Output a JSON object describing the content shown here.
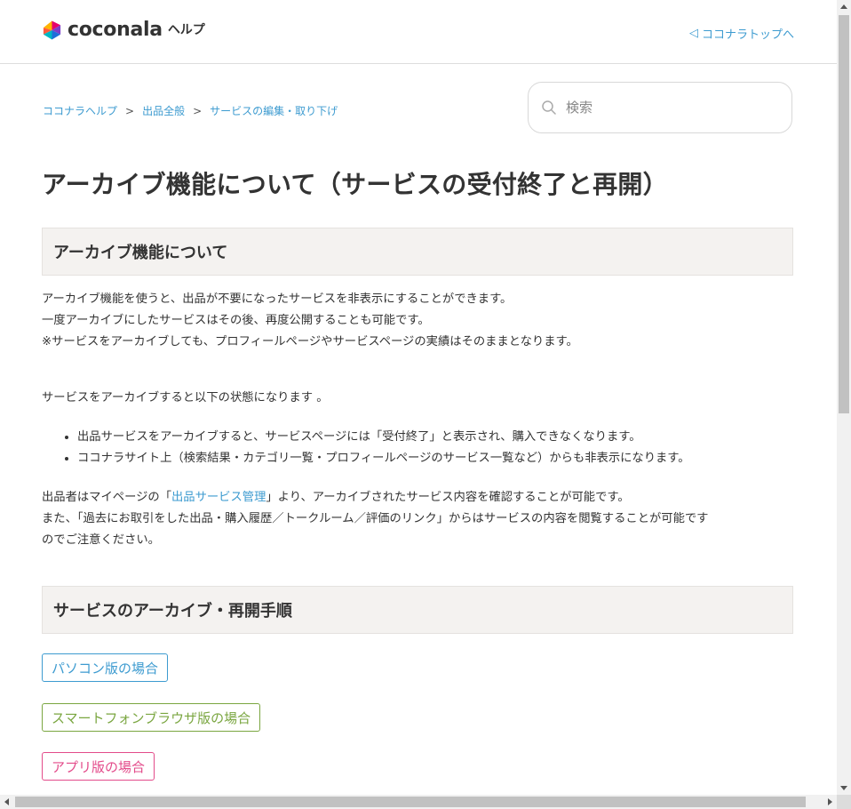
{
  "header": {
    "logo_text": "coconala",
    "logo_suffix": "ヘルプ",
    "top_link_label": "ココナラトップへ"
  },
  "breadcrumb": {
    "items": [
      {
        "label": "ココナラヘルプ"
      },
      {
        "label": "出品全般"
      },
      {
        "label": "サービスの編集・取り下げ"
      }
    ],
    "separator": ">"
  },
  "search": {
    "placeholder": "検索"
  },
  "article": {
    "title": "アーカイブ機能について（サービスの受付終了と再開）",
    "section1_heading": "アーカイブ機能について",
    "intro_lines": [
      "アーカイブ機能を使うと、出品が不要になったサービスを非表示にすることができます。",
      "一度アーカイブにしたサービスはその後、再度公開することも可能です。",
      "※サービスをアーカイブしても、プロフィールページやサービスページの実績はそのままとなります。"
    ],
    "state_intro": "サービスをアーカイブすると以下の状態になります 。",
    "bullets": [
      "出品サービスをアーカイブすると、サービスページには「受付終了」と表示され、購入できなくなります。",
      "ココナラサイト上（検索結果・カテゴリ一覧・プロフィールページのサービス一覧など）からも非表示になります。"
    ],
    "confirm_prefix": "出品者はマイページの「",
    "confirm_link": "出品サービス管理",
    "confirm_suffix": "」より、アーカイブされたサービス内容を確認することが可能です。",
    "notice_line1": "また、「過去にお取引をした出品・購入履歴／トークルーム／評価のリンク」からはサービスの内容を閲覧することが可能です",
    "notice_line2": "のでご注意ください。",
    "section2_heading": "サービスのアーカイブ・再開手順",
    "tags": {
      "pc": "パソコン版の場合",
      "smartphone": "スマートフォンブラウザ版の場合",
      "app": "アプリ版の場合"
    }
  },
  "colors": {
    "link": "#3d9bd0",
    "tag_pc": "#3d9bd0",
    "tag_smartphone": "#7aa640",
    "tag_app": "#e34b8a",
    "section_bg": "#f4f2f0"
  }
}
